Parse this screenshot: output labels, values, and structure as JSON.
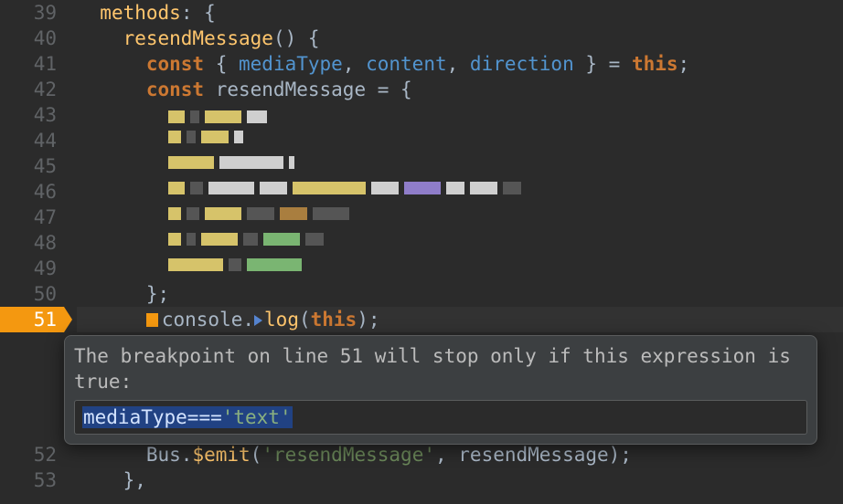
{
  "gutter": {
    "start": 39,
    "lines": [
      "39",
      "40",
      "41",
      "42",
      "43",
      "44",
      "45",
      "46",
      "47",
      "48",
      "49",
      "50",
      "51",
      "52",
      "53"
    ],
    "breakpoint_line": "51"
  },
  "code": {
    "l39_methods": "methods",
    "l39_colon": ":",
    "l39_brace": " {",
    "l40_fn": "resendMessage",
    "l40_parens": "() {",
    "l41_const": "const",
    "l41_open": " { ",
    "l41_p1": "mediaType",
    "l41_c1": ", ",
    "l41_p2": "content",
    "l41_c2": ", ",
    "l41_p3": "direction",
    "l41_close": " } = ",
    "l41_this": "this",
    "l41_semi": ";",
    "l42_const": "const",
    "l42_var": " resendMessage ",
    "l42_eq": "= {",
    "l50_close": "};",
    "l51_console": "console",
    "l51_dot": ".",
    "l51_log": "log",
    "l51_open": "(",
    "l51_this": "this",
    "l51_close": ");",
    "l52_bus": "Bus",
    "l52_dot": ".",
    "l52_emit": "$emit",
    "l52_open": "(",
    "l52_str": "'resendMessage'",
    "l52_comma": ", ",
    "l52_arg": "resendMessage",
    "l52_close": ");",
    "l53": "},"
  },
  "popup": {
    "label": "The breakpoint on line 51 will stop only if this expression is true:",
    "expression_id": "mediaType",
    "expression_op": "===",
    "expression_str": "'text'"
  }
}
